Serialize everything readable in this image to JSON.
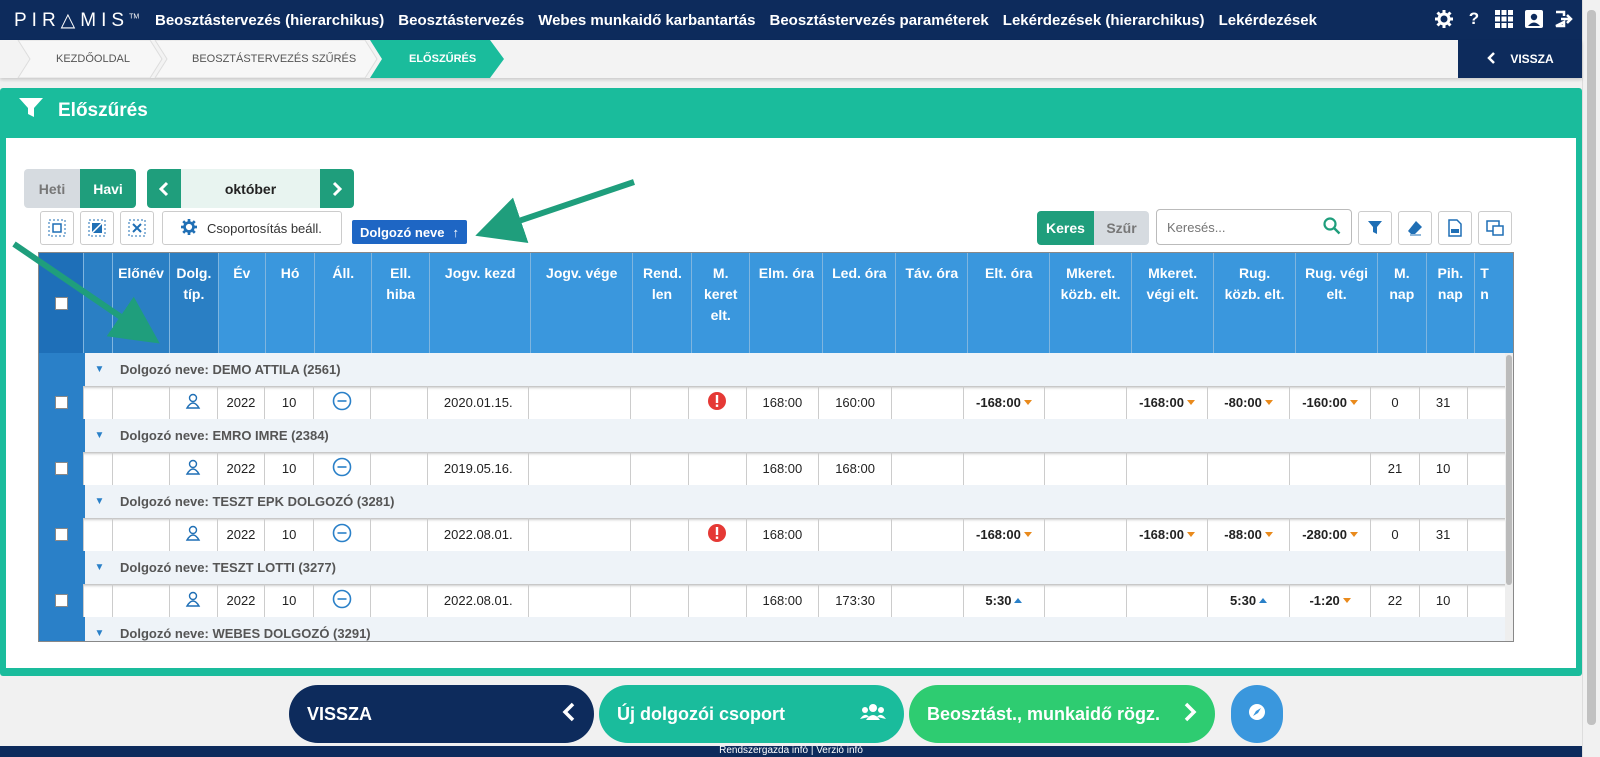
{
  "app": {
    "logo": "PIR△MIS",
    "logo_tm": "TM",
    "nav": [
      "Beosztástervezés (hierarchikus)",
      "Beosztástervezés",
      "Webes munkaidő karbantartás",
      "Beosztástervezés paraméterek",
      "Lekérdezések (hierarchikus)",
      "Lekérdezések"
    ],
    "nav_icons": [
      "gear-icon",
      "help-icon",
      "grid-icon",
      "user-icon",
      "logout-icon"
    ]
  },
  "breadcrumb": {
    "items": [
      "KEZDŐOLDAL",
      "BEOSZTÁSTERVEZÉS SZŰRÉS",
      "ELŐSZŰRÉS"
    ],
    "back_label": "VISSZA"
  },
  "panel": {
    "title": "Előszűrés"
  },
  "controls": {
    "period_weekly": "Heti",
    "period_monthly": "Havi",
    "month": "október",
    "grouping_label": "Csoportosítás beáll.",
    "sort_tag": "Dolgozó neve",
    "keres": "Keres",
    "szur": "Szűr",
    "search_placeholder": "Keresés..."
  },
  "table": {
    "headers": [
      "",
      "",
      "Előnév",
      "Dolg. típ.",
      "Év",
      "Hó",
      "Áll.",
      "Ell. hiba",
      "Jogv. kezd",
      "Jogv. vége",
      "Rend. len",
      "M. keret elt.",
      "Elm. óra",
      "Led. óra",
      "Táv. óra",
      "Elt. óra",
      "Mkeret. közb. elt.",
      "Mkeret. végi elt.",
      "Rug. közb. elt.",
      "Rug. végi elt.",
      "M. nap",
      "Pih. nap",
      "T n"
    ],
    "groups": [
      {
        "label": "Dolgozó neve: DEMO ATTILA (2561)",
        "row": {
          "ev": "2022",
          "ho": "10",
          "kezd": "2020.01.15.",
          "error": true,
          "elm": "168:00",
          "led": "160:00",
          "elt": "-168:00",
          "elt_dir": "down",
          "mkv": "-168:00",
          "mkv_dir": "down",
          "rk": "-80:00",
          "rk_dir": "down",
          "rv": "-160:00",
          "rv_dir": "down",
          "mnap": "0",
          "pnap": "31"
        }
      },
      {
        "label": "Dolgozó neve: EMRO IMRE (2384)",
        "row": {
          "ev": "2022",
          "ho": "10",
          "kezd": "2019.05.16.",
          "error": false,
          "elm": "168:00",
          "led": "168:00",
          "elt": "",
          "elt_dir": "",
          "mkv": "",
          "mkv_dir": "",
          "rk": "",
          "rk_dir": "",
          "rv": "",
          "rv_dir": "",
          "mnap": "21",
          "pnap": "10"
        }
      },
      {
        "label": "Dolgozó neve: TESZT EPK DOLGOZÓ (3281)",
        "row": {
          "ev": "2022",
          "ho": "10",
          "kezd": "2022.08.01.",
          "error": true,
          "elm": "168:00",
          "led": "",
          "elt": "-168:00",
          "elt_dir": "down",
          "mkv": "-168:00",
          "mkv_dir": "down",
          "rk": "-88:00",
          "rk_dir": "down",
          "rv": "-280:00",
          "rv_dir": "down",
          "mnap": "0",
          "pnap": "31"
        }
      },
      {
        "label": "Dolgozó neve: TESZT LOTTI (3277)",
        "row": {
          "ev": "2022",
          "ho": "10",
          "kezd": "2022.08.01.",
          "error": false,
          "elm": "168:00",
          "led": "173:30",
          "elt": "5:30",
          "elt_dir": "up",
          "mkv": "",
          "mkv_dir": "",
          "rk": "5:30",
          "rk_dir": "up",
          "rv": "-1:20",
          "rv_dir": "down",
          "mnap": "22",
          "pnap": "10"
        }
      },
      {
        "label": "Dolgozó neve: WEBES DOLGOZÓ (3291)",
        "row": null
      }
    ]
  },
  "bottom": {
    "back": "VISSZA",
    "new_group": "Új dolgozói csoport",
    "record": "Beosztást., munkaidő rögz."
  },
  "footer": {
    "text": "Rendszergazda infó   |   Verzió infó"
  },
  "colors": {
    "navy": "#0d2b5c",
    "teal": "#1abc9c",
    "green": "#1f9e7c",
    "blue_header": "#3a97dd",
    "error_red": "#e53935"
  }
}
